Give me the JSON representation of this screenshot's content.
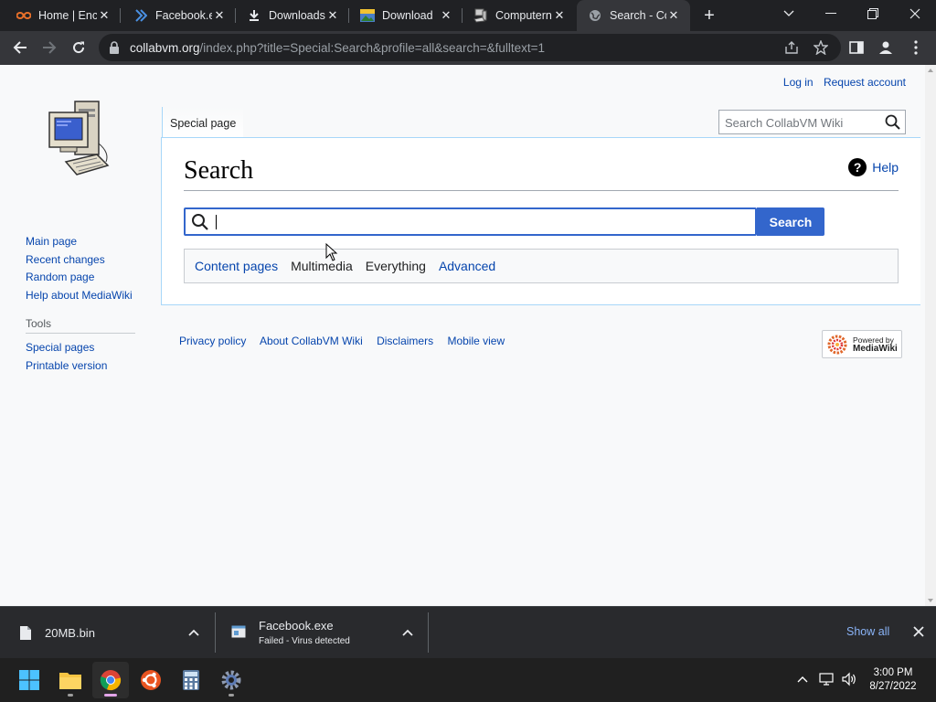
{
  "browser": {
    "tabs": [
      {
        "title": "Home | Enc",
        "favicon": "orange-logo-icon"
      },
      {
        "title": "Facebook.e",
        "favicon": "chevron-favicon-icon"
      },
      {
        "title": "Downloads",
        "favicon": "download-icon"
      },
      {
        "title": "Download",
        "favicon": "picture-favicon-icon"
      },
      {
        "title": "Computern",
        "favicon": "computer-favicon-icon"
      },
      {
        "title": "Search - Co",
        "favicon": "globe-icon",
        "active": true
      }
    ],
    "url_host": "collabvm.org",
    "url_path": "/index.php?title=Special:Search&profile=all&search=&fulltext=1"
  },
  "wiki": {
    "personal": {
      "login": "Log in",
      "request": "Request account"
    },
    "page_tab": "Special page",
    "search_placeholder": "Search CollabVM Wiki",
    "heading": "Search",
    "help": "Help",
    "search_value": "",
    "search_button": "Search",
    "profiles": [
      {
        "label": "Content pages",
        "current": false
      },
      {
        "label": "Multimedia",
        "current": false
      },
      {
        "label": "Everything",
        "current": true
      },
      {
        "label": "Advanced",
        "current": false
      }
    ],
    "nav": [
      "Main page",
      "Recent changes",
      "Random page",
      "Help about MediaWiki"
    ],
    "tools_heading": "Tools",
    "tools": [
      "Special pages",
      "Printable version"
    ],
    "footer": [
      "Privacy policy",
      "About CollabVM Wiki",
      "Disclaimers",
      "Mobile view"
    ],
    "powered_by_line1": "Powered by",
    "powered_by_line2": "MediaWiki"
  },
  "downloads": {
    "items": [
      {
        "name": "20MB.bin",
        "status": ""
      },
      {
        "name": "Facebook.exe",
        "status": "Failed - Virus detected"
      }
    ],
    "show_all": "Show all"
  },
  "taskbar": {
    "apps": [
      "start-icon",
      "file-explorer-icon",
      "chrome-icon",
      "ubuntu-icon",
      "calculator-icon",
      "settings-icon"
    ],
    "time": "3:00 PM",
    "date": "8/27/2022"
  },
  "colors": {
    "link": "#0645ad",
    "accent": "#3366cc",
    "show_all": "#8ab4f8"
  }
}
